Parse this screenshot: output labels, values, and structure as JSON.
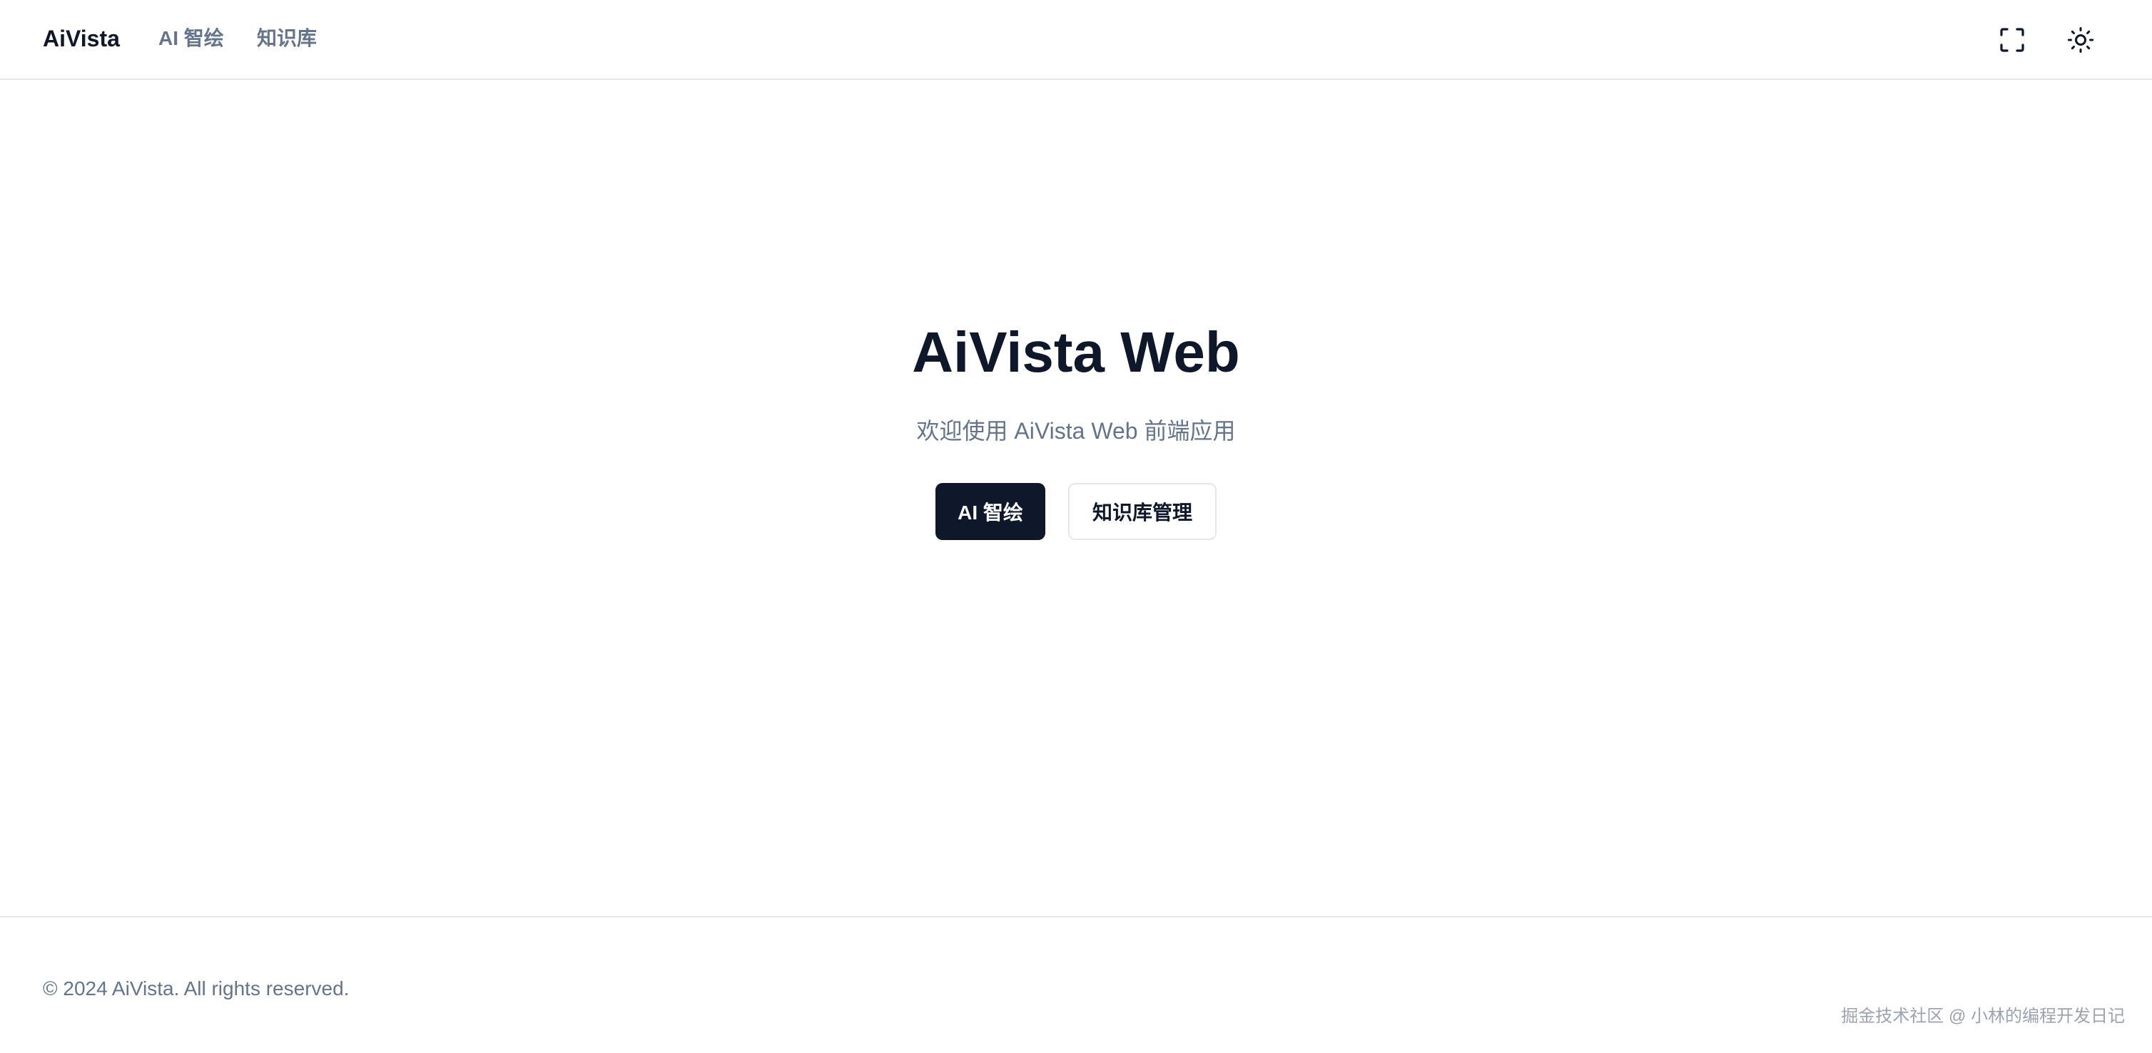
{
  "header": {
    "brand": "AiVista",
    "nav": [
      {
        "label": "AI 智绘"
      },
      {
        "label": "知识库"
      }
    ],
    "icons": {
      "fullscreen": "fullscreen-icon",
      "theme": "sun-icon"
    }
  },
  "hero": {
    "title": "AiVista Web",
    "subtitle": "欢迎使用 AiVista Web 前端应用",
    "primary_button": "AI 智绘",
    "secondary_button": "知识库管理"
  },
  "footer": {
    "copyright": "© 2024 AiVista. All rights reserved."
  },
  "watermark": "掘金技术社区 @ 小林的编程开发日记",
  "colors": {
    "primary": "#0f172a",
    "muted": "#64748b",
    "border": "#e5e7eb",
    "background": "#ffffff"
  }
}
